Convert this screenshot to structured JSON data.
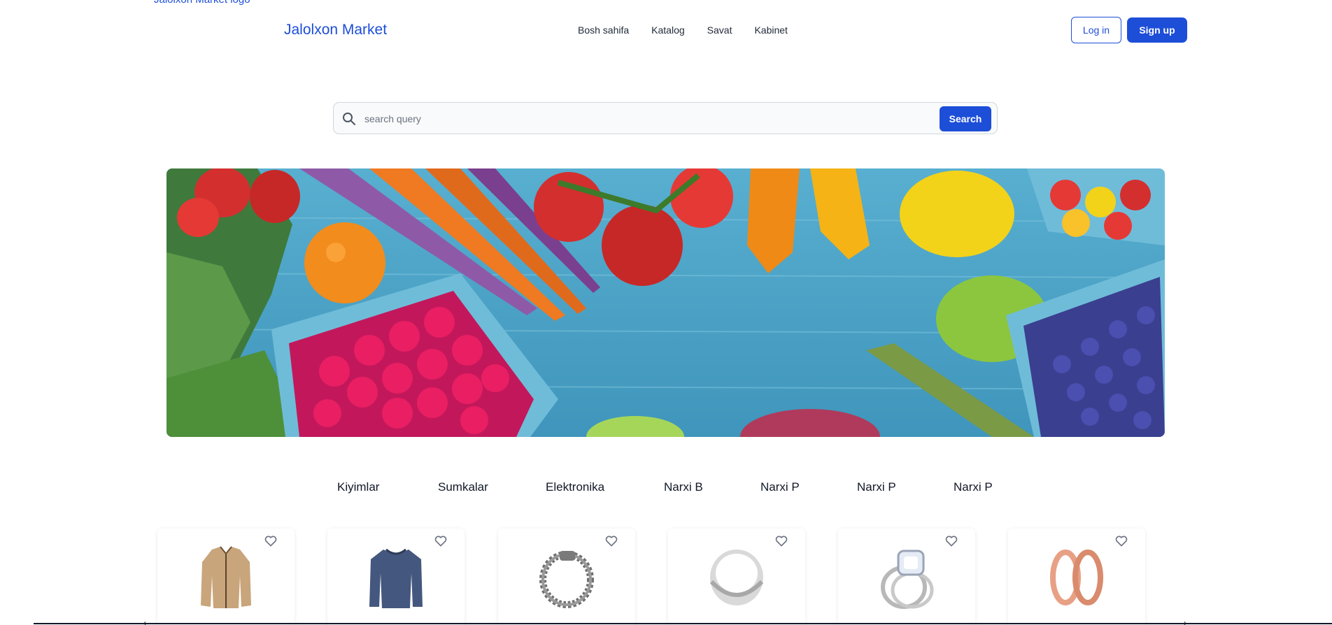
{
  "logo_alt_text": "Jalolxon Market logo",
  "brand": "Jalolxon Market",
  "nav": [
    {
      "label": "Bosh sahifa"
    },
    {
      "label": "Katalog"
    },
    {
      "label": "Savat"
    },
    {
      "label": "Kabinet"
    }
  ],
  "auth": {
    "login_label": "Log in",
    "signup_label": "Sign up"
  },
  "search": {
    "placeholder": "search query",
    "value": "",
    "button_label": "Search"
  },
  "categories": [
    "Kiyimlar",
    "Sumkalar",
    "Elektronika",
    "Narxi B",
    "Narxi P",
    "Narxi P",
    "Narxi P"
  ],
  "products": [
    {
      "icon": "jacket-icon"
    },
    {
      "icon": "sweater-icon"
    },
    {
      "icon": "bracelet-icon"
    },
    {
      "icon": "silver-ring-icon"
    },
    {
      "icon": "diamond-ring-icon"
    },
    {
      "icon": "gold-rings-icon"
    }
  ],
  "colors": {
    "accent": "#1d4ed8",
    "text": "#1f2937",
    "search_bg": "#f9fafb",
    "banner_wood": "#4aa3c6"
  }
}
